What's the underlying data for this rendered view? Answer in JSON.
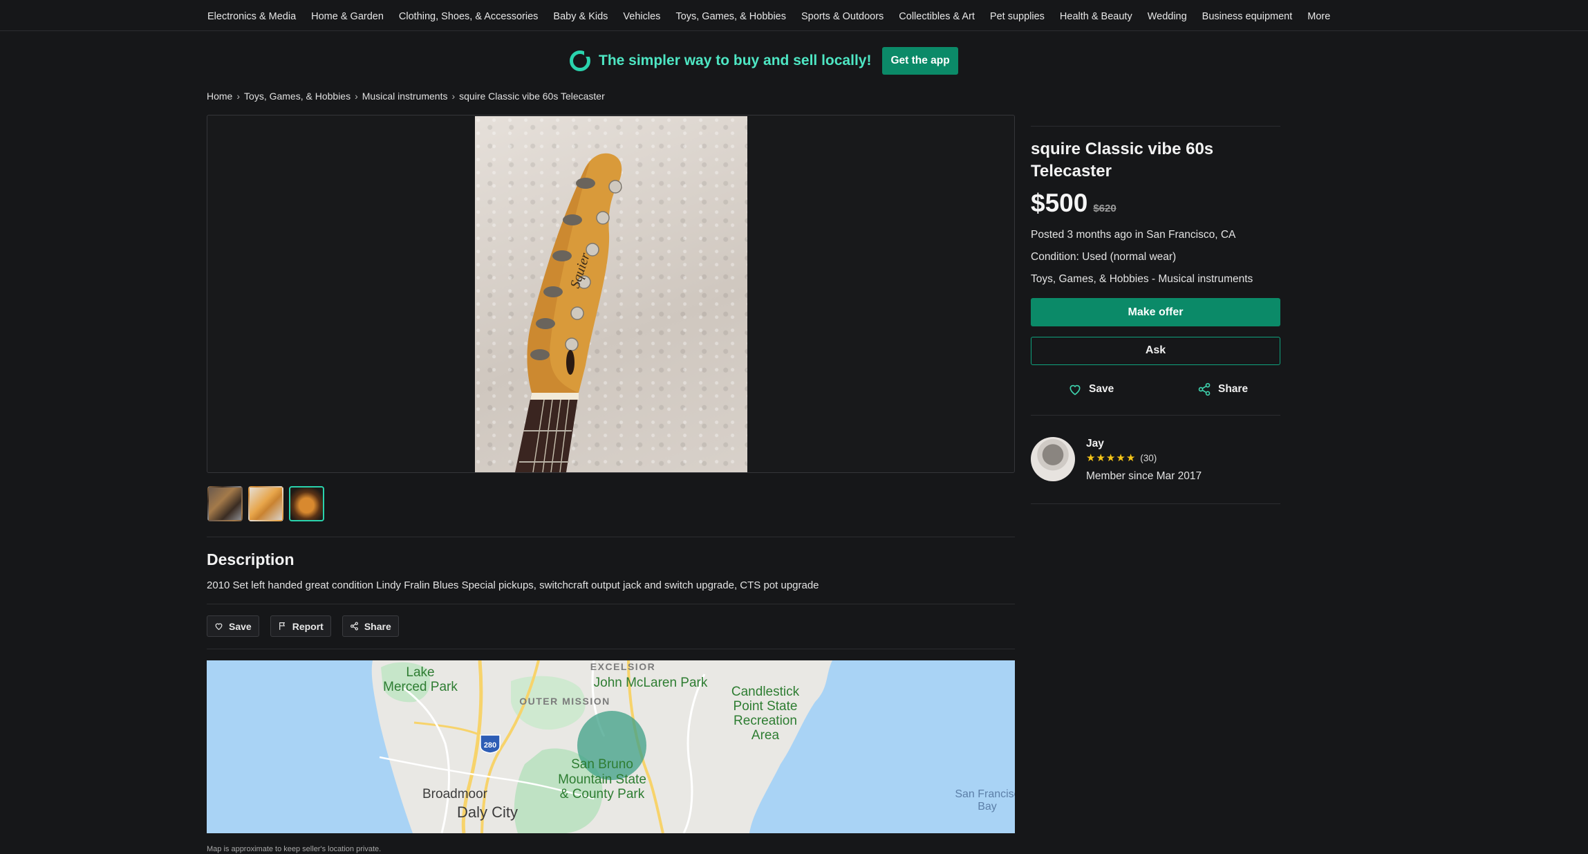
{
  "nav": {
    "categories": [
      "Electronics & Media",
      "Home & Garden",
      "Clothing, Shoes, & Accessories",
      "Baby & Kids",
      "Vehicles",
      "Toys, Games, & Hobbies",
      "Sports & Outdoors",
      "Collectibles & Art",
      "Pet supplies",
      "Health & Beauty",
      "Wedding",
      "Business equipment",
      "More"
    ]
  },
  "banner": {
    "text": "The simpler way to buy and sell locally!",
    "button": "Get the app",
    "accent": "#2ad3ad",
    "button_color": "#0b8a68"
  },
  "breadcrumb": {
    "items": [
      "Home",
      "Toys, Games, & Hobbies",
      "Musical instruments",
      "squire Classic vibe 60s Telecaster"
    ],
    "separator": "›"
  },
  "gallery": {
    "thumbnails": 3,
    "active_thumbnail": 3
  },
  "description": {
    "heading": "Description",
    "text": "2010 Set left handed great condition Lindy Fralin Blues Special pickups, switchcraft output jack and switch upgrade, CTS pot upgrade"
  },
  "actions": {
    "save": "Save",
    "report": "Report",
    "share": "Share"
  },
  "map": {
    "labels": {
      "lake_merced_1": "Lake",
      "lake_merced_2": "Merced Park",
      "excelsior": "EXCELSIOR",
      "mclaren": "John McLaren Park",
      "outer_mission": "OUTER MISSION",
      "candlestick_1": "Candlestick",
      "candlestick_2": "Point State",
      "candlestick_3": "Recreation",
      "candlestick_4": "Area",
      "i280": "280",
      "sanbruno_1": "San Bruno",
      "sanbruno_2": "Mountain State",
      "sanbruno_3": "& County Park",
      "broadmoor": "Broadmoor",
      "daly_city": "Daly City",
      "sf_bay_1": "San Francisc",
      "sf_bay_2": "Bay"
    },
    "caption": "Map is approximate to keep seller's location private."
  },
  "listing": {
    "title": "squire Classic vibe 60s Telecaster",
    "price": "$500",
    "original_price": "$620",
    "posted": "Posted 3 months ago in San Francisco, CA",
    "condition": "Condition: Used (normal wear)",
    "category": "Toys, Games, & Hobbies - Musical instruments",
    "make_offer": "Make offer",
    "ask": "Ask",
    "save": "Save",
    "share": "Share"
  },
  "seller": {
    "name": "Jay",
    "rating": 5,
    "rating_count": "(30)",
    "member_since": "Member since Mar 2017"
  }
}
